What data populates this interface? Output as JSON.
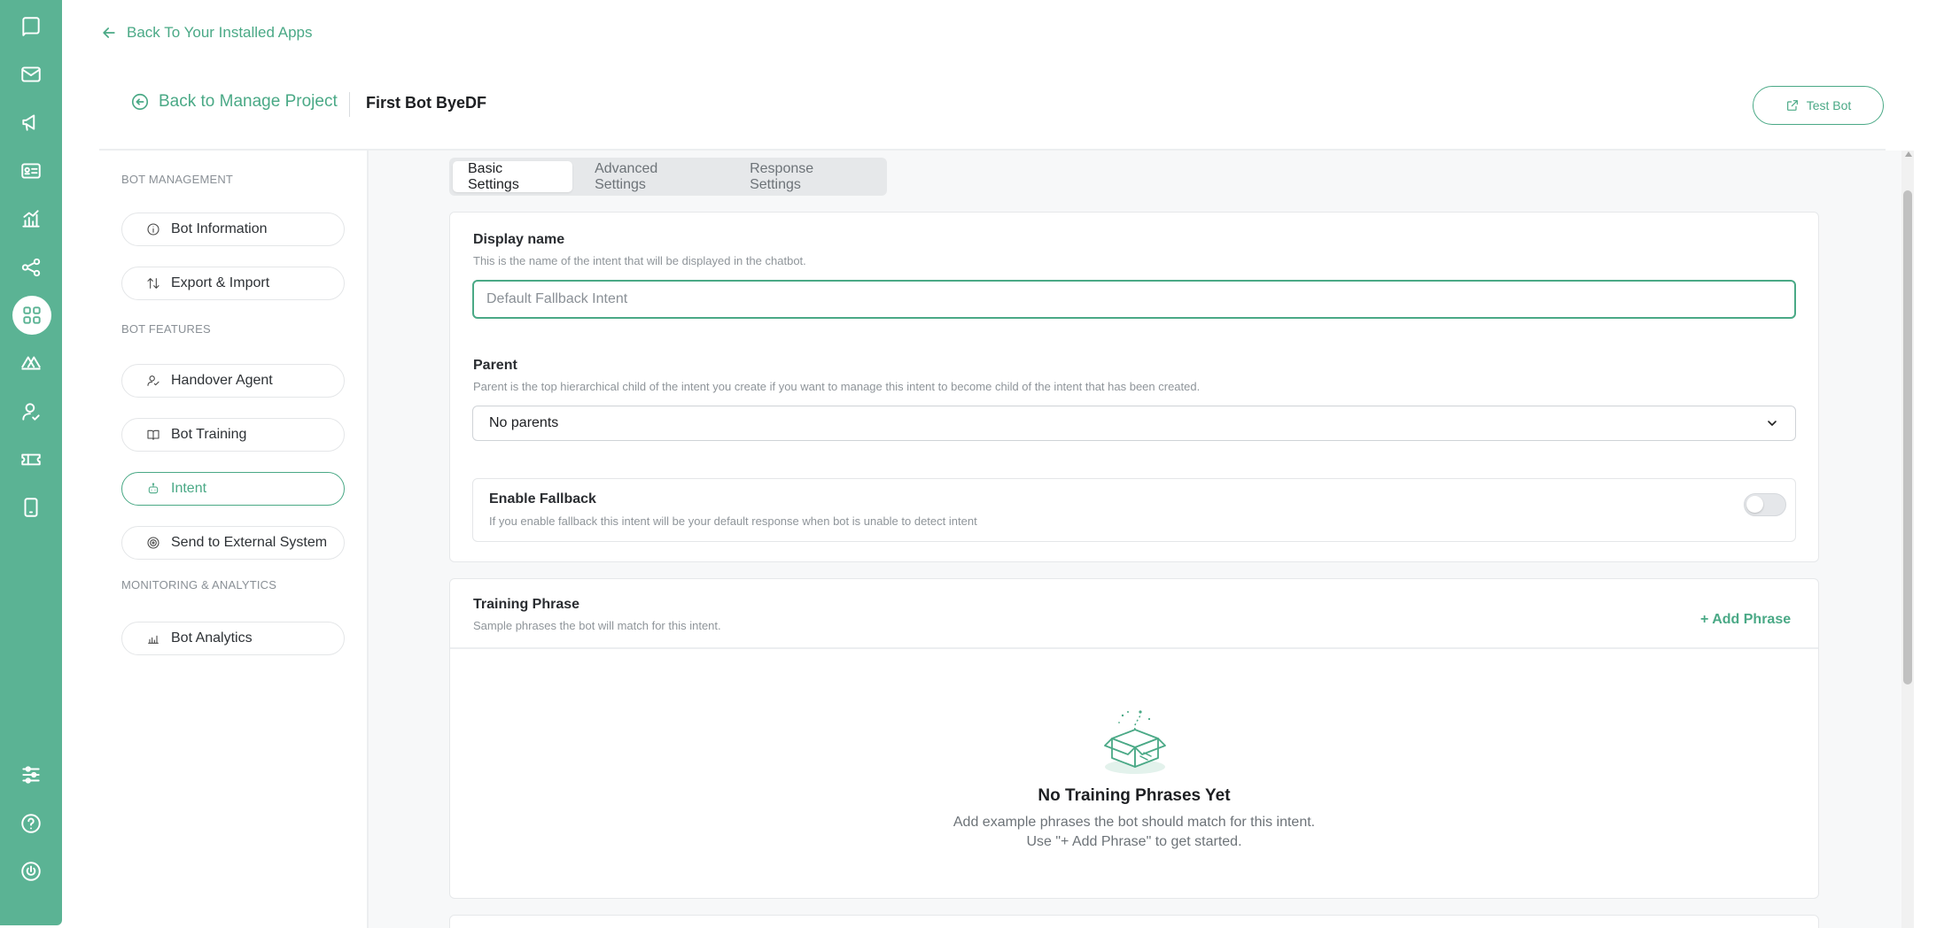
{
  "rail": {
    "icons": [
      "chat-icon",
      "mail-icon",
      "megaphone-icon",
      "contact-card-icon",
      "analytics-icon",
      "share-nodes-icon",
      "apps-grid-icon",
      "integration-icon",
      "agent-icon",
      "ticket-icon",
      "tablet-icon",
      "sliders-icon",
      "help-icon",
      "power-icon"
    ],
    "active": "apps-grid-icon"
  },
  "top_link": {
    "label": "Back To Your Installed Apps"
  },
  "header": {
    "back_label": "Back to Manage Project",
    "project_title": "First Bot ByeDF",
    "test_bot_label": "Test Bot"
  },
  "sidebar": {
    "sections": [
      {
        "label": "BOT MANAGEMENT"
      },
      {
        "label": "BOT FEATURES"
      },
      {
        "label": "MONITORING & ANALYTICS"
      }
    ],
    "items": [
      {
        "label": "Bot Information",
        "icon": "info-icon"
      },
      {
        "label": "Export & Import",
        "icon": "swap-arrows-icon"
      },
      {
        "label": "Handover Agent",
        "icon": "user-check-icon"
      },
      {
        "label": "Bot Training",
        "icon": "book-icon"
      },
      {
        "label": "Intent",
        "icon": "robot-icon",
        "active": true
      },
      {
        "label": "Send to External System",
        "icon": "target-icon"
      },
      {
        "label": "Bot Analytics",
        "icon": "chart-icon"
      }
    ]
  },
  "tabs": [
    {
      "label": "Basic Settings",
      "active": true
    },
    {
      "label": "Advanced Settings"
    },
    {
      "label": "Response Settings"
    }
  ],
  "basic": {
    "display_name": {
      "label": "Display name",
      "help": "This is the name of the intent that will be displayed in the chatbot.",
      "placeholder": "Default Fallback Intent",
      "value": ""
    },
    "parent": {
      "label": "Parent",
      "help": "Parent is the top hierarchical child of the intent you create if you want to manage this intent to become child of the intent that has been created.",
      "selected": "No parents"
    },
    "fallback": {
      "title": "Enable Fallback",
      "description": "If you enable fallback this intent will be your default response when bot is unable to detect intent",
      "enabled": false
    }
  },
  "training": {
    "title": "Training Phrase",
    "subtitle": "Sample phrases the bot will match for this intent.",
    "add_label": "+ Add Phrase",
    "empty_title": "No Training Phrases Yet",
    "empty_line1": "Add example phrases the bot should match for this intent.",
    "empty_line2": "Use \"+ Add Phrase\" to get started."
  },
  "colors": {
    "accent": "#5bb394",
    "accent_text": "#4aa986"
  }
}
